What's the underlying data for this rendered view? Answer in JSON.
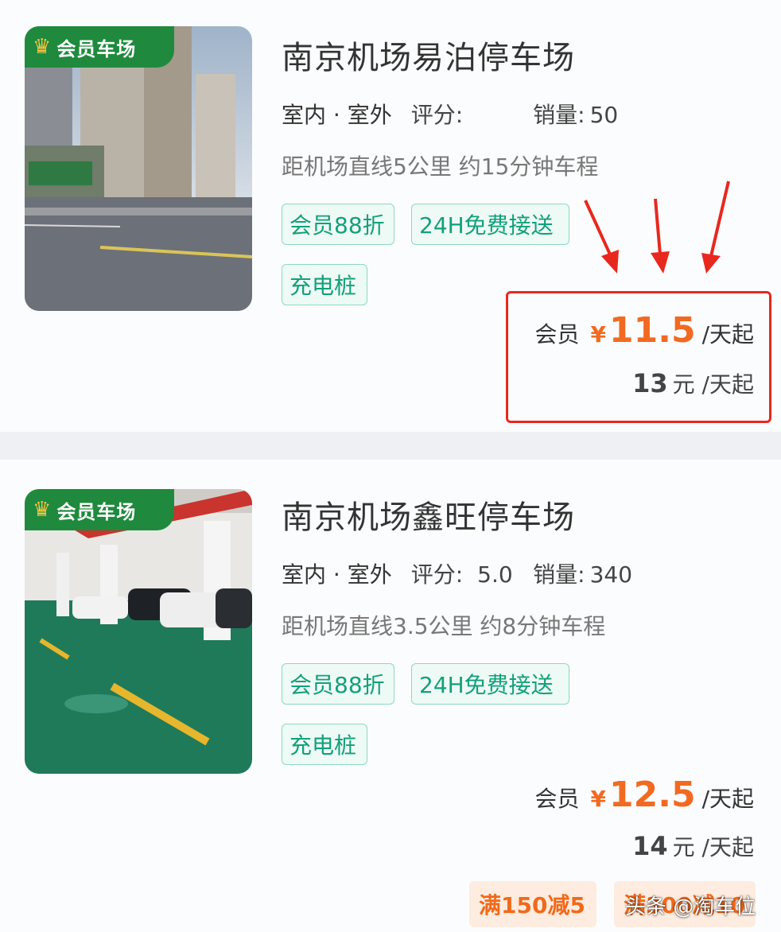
{
  "listings": [
    {
      "badge": "会员车场",
      "title": "南京机场易泊停车场",
      "location_type": "室内 · 室外",
      "rating_label": "评分:",
      "rating_value": "",
      "sales_label": "销量:",
      "sales_value": "50",
      "distance": "距机场直线5公里 约15分钟车程",
      "tags": [
        "会员88折",
        "24H免费接送",
        "充电桩"
      ],
      "member_label": "会员",
      "currency": "¥",
      "member_price": "11.5",
      "member_unit": "/天起",
      "regular_price": "13",
      "regular_unit": "元 /天起"
    },
    {
      "badge": "会员车场",
      "title": "南京机场鑫旺停车场",
      "location_type": "室内 · 室外",
      "rating_label": "评分:",
      "rating_value": "5.0",
      "sales_label": "销量:",
      "sales_value": "340",
      "distance": "距机场直线3.5公里 约8分钟车程",
      "tags": [
        "会员88折",
        "24H免费接送",
        "充电桩"
      ],
      "member_label": "会员",
      "currency": "¥",
      "member_price": "12.5",
      "member_unit": "/天起",
      "regular_price": "14",
      "regular_unit": "元 /天起",
      "promos": [
        "满150减5",
        "满300减10"
      ]
    }
  ],
  "watermark": "头条 @淘车位",
  "colors": {
    "accent_orange": "#f26a21",
    "badge_green": "#1f8a3d",
    "tag_green": "#12a07a",
    "highlight_red": "#e8281e"
  },
  "icons": [
    "crown-icon",
    "arrow-down-icon"
  ]
}
